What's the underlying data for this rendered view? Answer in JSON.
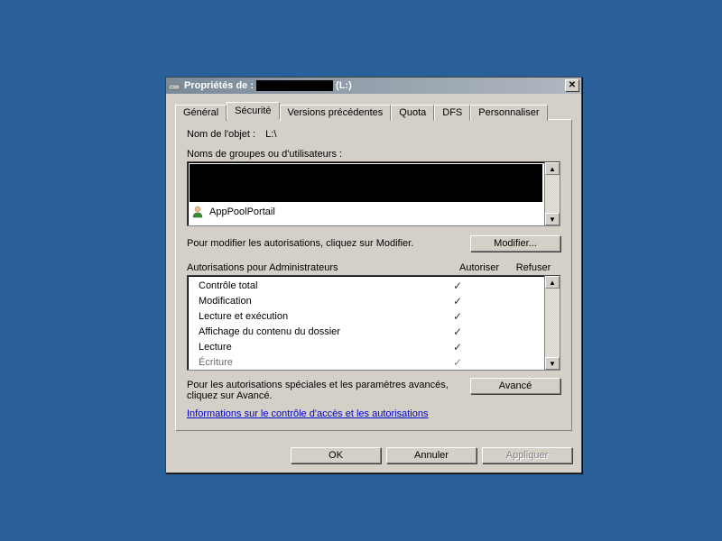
{
  "title": {
    "prefix": "Propriétés de :",
    "suffix": "(L:)"
  },
  "tabs": [
    {
      "label": "Général"
    },
    {
      "label": "Sécurité"
    },
    {
      "label": "Versions précédentes"
    },
    {
      "label": "Quota"
    },
    {
      "label": "DFS"
    },
    {
      "label": "Personnaliser"
    }
  ],
  "active_tab": 1,
  "security": {
    "object_name_label": "Nom de l'objet :",
    "object_name_value": "L:\\",
    "principals_label": "Noms de groupes ou d'utilisateurs :",
    "visible_principal": "AppPoolPortail",
    "modify_hint": "Pour modifier les autorisations, cliquez sur Modifier.",
    "modify_button": "Modifier...",
    "perms_for_label": "Autorisations pour Administrateurs",
    "col_allow": "Autoriser",
    "col_deny": "Refuser",
    "permissions": [
      {
        "name": "Contrôle total",
        "allow": true,
        "deny": false
      },
      {
        "name": "Modification",
        "allow": true,
        "deny": false
      },
      {
        "name": "Lecture et exécution",
        "allow": true,
        "deny": false
      },
      {
        "name": "Affichage du contenu du dossier",
        "allow": true,
        "deny": false
      },
      {
        "name": "Lecture",
        "allow": true,
        "deny": false
      },
      {
        "name": "Écriture",
        "allow": true,
        "deny": false
      }
    ],
    "advanced_hint": "Pour les autorisations spéciales et les paramètres avancés, cliquez sur Avancé.",
    "advanced_button": "Avancé",
    "help_link": "Informations sur le contrôle d'accès et les autorisations"
  },
  "buttons": {
    "ok": "OK",
    "cancel": "Annuler",
    "apply": "Appliquer"
  }
}
